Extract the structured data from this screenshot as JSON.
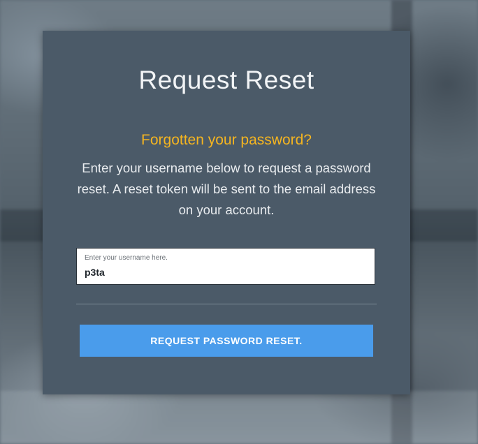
{
  "form": {
    "title": "Request Reset",
    "subtitle": "Forgotten your password?",
    "description": "Enter your username below to request a password reset. A reset token will be sent to the email address on your account.",
    "username_label": "Enter your username here.",
    "username_value": "p3ta",
    "submit_label": "REQUEST PASSWORD RESET."
  },
  "colors": {
    "card_background": "#4b5a68",
    "subtitle_accent": "#f5b520",
    "button_background": "#4a9ceb"
  }
}
